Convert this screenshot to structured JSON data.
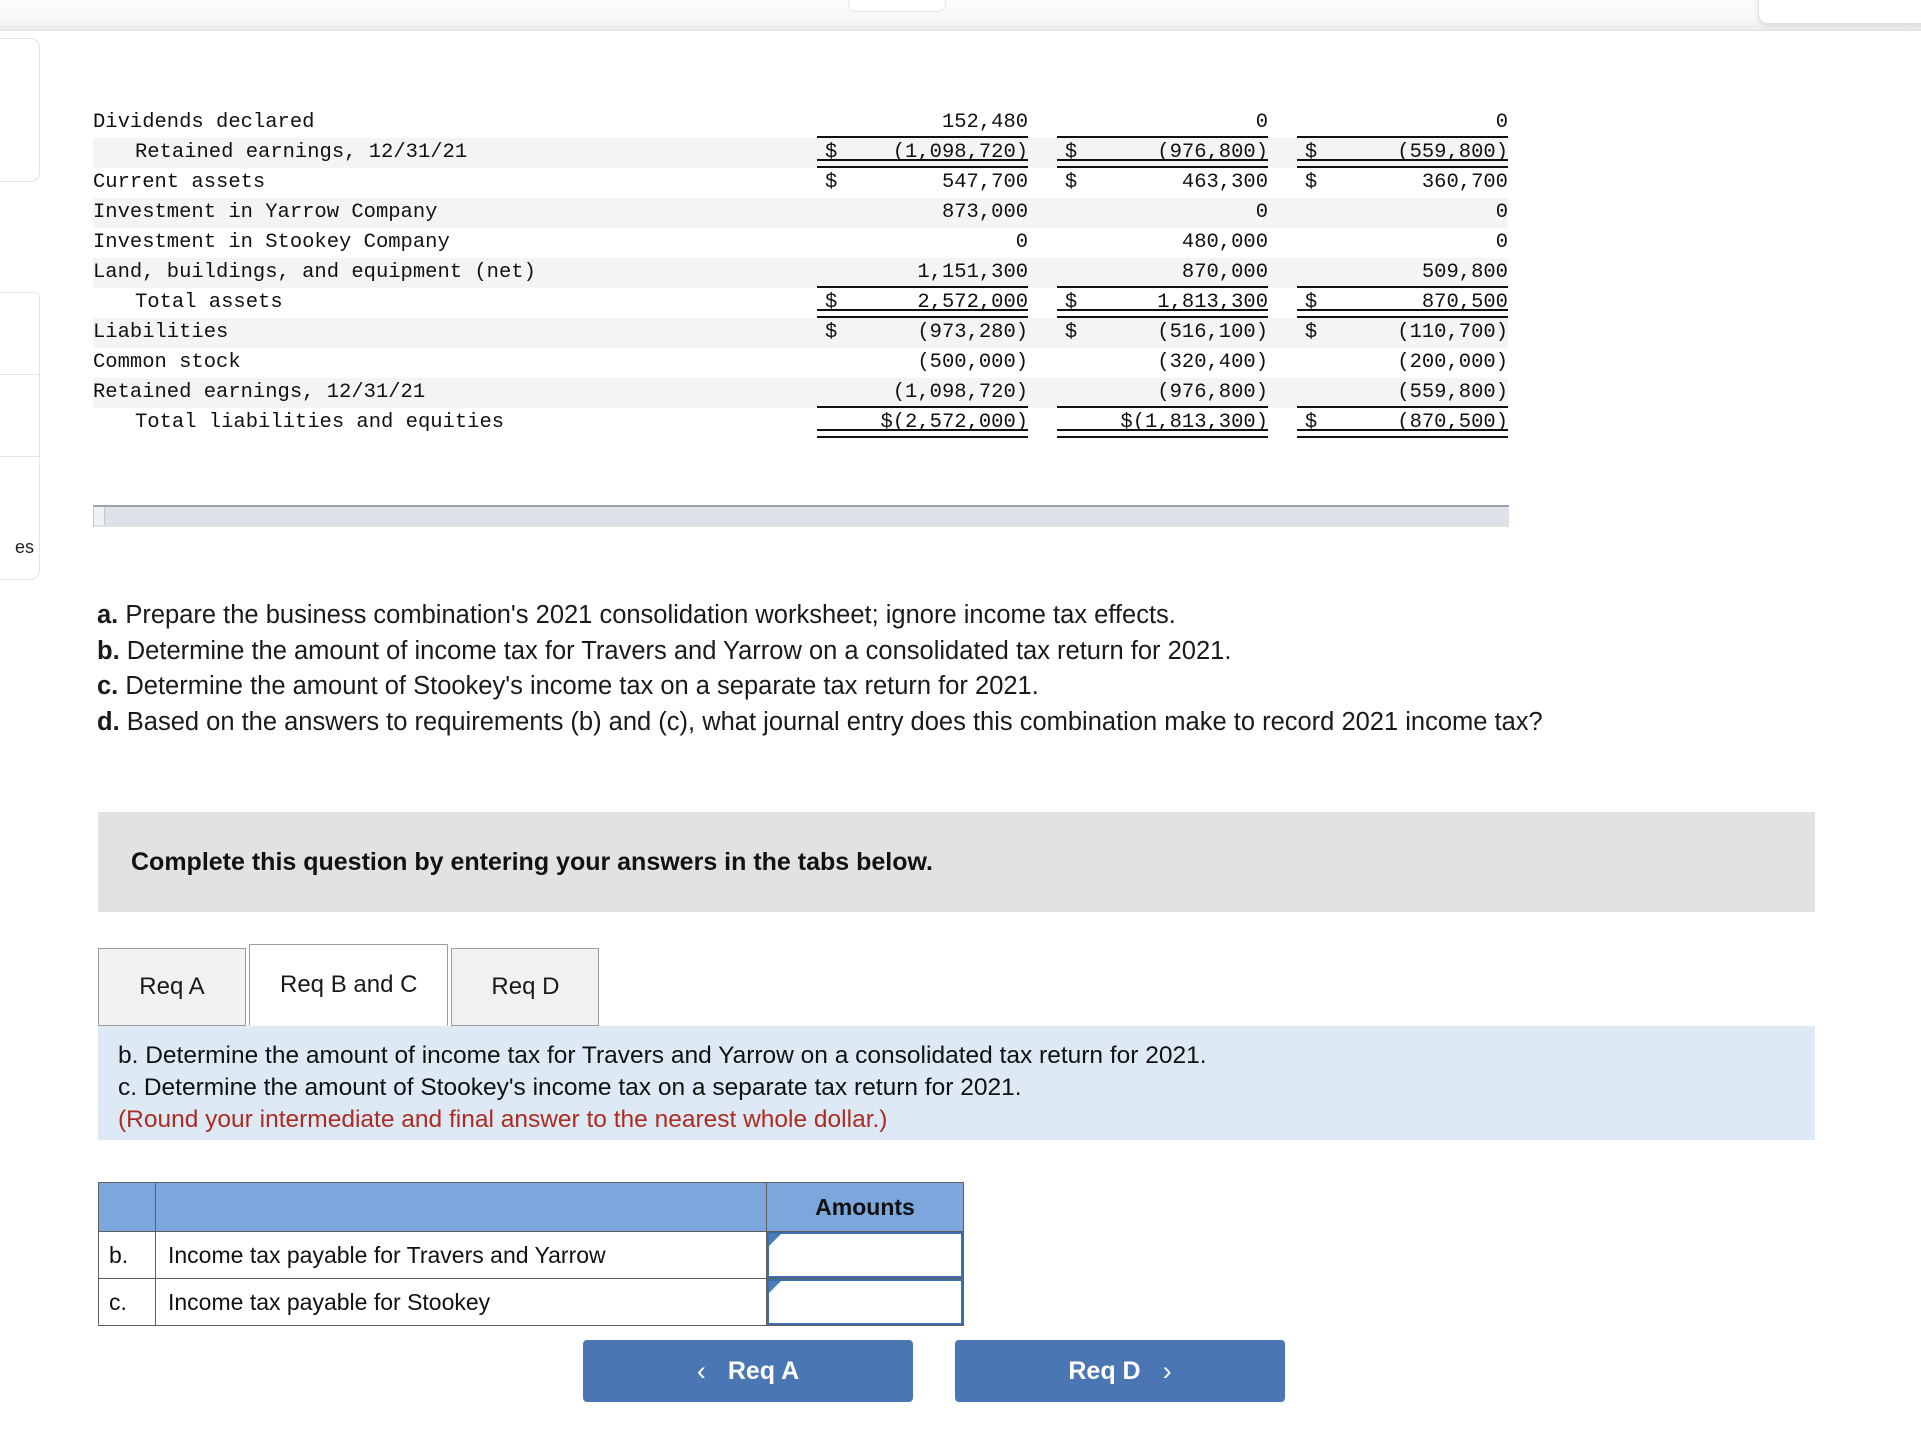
{
  "worksheet": {
    "columns_count": 4,
    "rows": [
      {
        "label": "Dividends declared",
        "indent": 0,
        "shade": false,
        "rule": "underline",
        "values": [
          {
            "currency": "",
            "text": "152,480"
          },
          {
            "currency": "",
            "text": "0"
          },
          {
            "currency": "",
            "text": "0"
          }
        ]
      },
      {
        "label": "Retained earnings, 12/31/21",
        "indent": 1,
        "shade": true,
        "rule": "double",
        "values": [
          {
            "currency": "$",
            "text": "(1,098,720)"
          },
          {
            "currency": "$",
            "text": "(976,800)"
          },
          {
            "currency": "$",
            "text": "(559,800)"
          }
        ]
      },
      {
        "label": "Current assets",
        "indent": 0,
        "shade": false,
        "rule": "none",
        "values": [
          {
            "currency": "$",
            "text": "547,700"
          },
          {
            "currency": "$",
            "text": "463,300"
          },
          {
            "currency": "$",
            "text": "360,700"
          }
        ]
      },
      {
        "label": "Investment in Yarrow Company",
        "indent": 0,
        "shade": true,
        "rule": "none",
        "values": [
          {
            "currency": "",
            "text": "873,000"
          },
          {
            "currency": "",
            "text": "0"
          },
          {
            "currency": "",
            "text": "0"
          }
        ]
      },
      {
        "label": "Investment in Stookey Company",
        "indent": 0,
        "shade": false,
        "rule": "none",
        "values": [
          {
            "currency": "",
            "text": "0"
          },
          {
            "currency": "",
            "text": "480,000"
          },
          {
            "currency": "",
            "text": "0"
          }
        ]
      },
      {
        "label": "Land, buildings, and equipment (net)",
        "indent": 0,
        "shade": true,
        "rule": "underline",
        "values": [
          {
            "currency": "",
            "text": "1,151,300"
          },
          {
            "currency": "",
            "text": "870,000"
          },
          {
            "currency": "",
            "text": "509,800"
          }
        ]
      },
      {
        "label": "Total assets",
        "indent": 1,
        "shade": false,
        "rule": "double",
        "values": [
          {
            "currency": "$",
            "text": "2,572,000"
          },
          {
            "currency": "$",
            "text": "1,813,300"
          },
          {
            "currency": "$",
            "text": "870,500"
          }
        ]
      },
      {
        "label": "Liabilities",
        "indent": 0,
        "shade": true,
        "rule": "none",
        "values": [
          {
            "currency": "$",
            "text": "(973,280)"
          },
          {
            "currency": "$",
            "text": "(516,100)"
          },
          {
            "currency": "$",
            "text": "(110,700)"
          }
        ]
      },
      {
        "label": "Common stock",
        "indent": 0,
        "shade": false,
        "rule": "none",
        "values": [
          {
            "currency": "",
            "text": "(500,000)"
          },
          {
            "currency": "",
            "text": "(320,400)"
          },
          {
            "currency": "",
            "text": "(200,000)"
          }
        ]
      },
      {
        "label": "Retained earnings, 12/31/21",
        "indent": 0,
        "shade": true,
        "rule": "underline",
        "values": [
          {
            "currency": "",
            "text": "(1,098,720)"
          },
          {
            "currency": "",
            "text": "(976,800)"
          },
          {
            "currency": "",
            "text": "(559,800)"
          }
        ]
      },
      {
        "label": "Total liabilities and equities",
        "indent": 1,
        "shade": false,
        "rule": "double",
        "values": [
          {
            "currency": "",
            "text": "$(2,572,000)"
          },
          {
            "currency": "",
            "text": "$(1,813,300)"
          },
          {
            "currency": "$",
            "text": "(870,500)"
          }
        ]
      }
    ]
  },
  "requirements": [
    {
      "key": "a.",
      "text": " Prepare the business combination's 2021 consolidation worksheet; ignore income tax effects."
    },
    {
      "key": "b.",
      "text": " Determine the amount of income tax for Travers and Yarrow on a consolidated tax return for 2021."
    },
    {
      "key": "c.",
      "text": " Determine the amount of Stookey's income tax on a separate tax return for 2021."
    },
    {
      "key": "d.",
      "text": " Based on the answers to requirements (b) and (c), what journal entry does this combination make to record 2021 income tax?"
    }
  ],
  "banner": {
    "text": "Complete this question by entering your answers in the tabs below."
  },
  "tabs": [
    {
      "label": "Req A",
      "active": false
    },
    {
      "label": "Req B and C",
      "active": true
    },
    {
      "label": "Req D",
      "active": false
    }
  ],
  "instructions": {
    "line_b": "b. Determine the amount of income tax for Travers and Yarrow on a consolidated tax return for 2021.",
    "line_c": "c. Determine the amount of Stookey's income tax on a separate tax return for 2021.",
    "note": "(Round your intermediate and final answer to the nearest whole dollar.)",
    "note_color": "#ad2b21"
  },
  "answer_table": {
    "headers": {
      "key": "",
      "description": "",
      "amount": "Amounts"
    },
    "header_bg": "#7ba7dd",
    "rows": [
      {
        "key": "b.",
        "description": "Income tax payable for Travers and Yarrow",
        "amount": "",
        "placeholder": ""
      },
      {
        "key": "c.",
        "description": "Income tax payable for Stookey",
        "amount": "",
        "placeholder": ""
      }
    ]
  },
  "nav": {
    "prev": {
      "label": "Req A",
      "chevron": "‹",
      "icon": "chevron-left-icon"
    },
    "next": {
      "label": "Req D",
      "chevron": "›",
      "icon": "chevron-right-icon"
    },
    "color": "#4a77b4"
  },
  "left_panel": {
    "clipped_text": "es"
  }
}
